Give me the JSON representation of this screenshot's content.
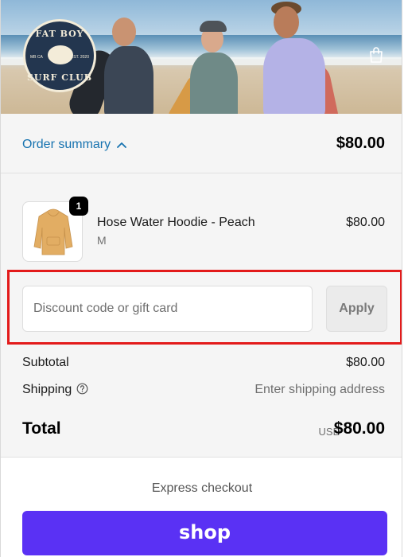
{
  "brand": {
    "logo_text_top": "FAT BOY",
    "logo_text_bottom": "SURF CLUB",
    "logo_small_left": "MB CA",
    "logo_small_right": "EST. 2020"
  },
  "header": {
    "bag_icon": "shopping-bag-icon"
  },
  "order_summary": {
    "toggle_label": "Order summary",
    "toggle_icon": "chevron-up-icon",
    "total": "$80.00",
    "accent_color": "#1773b0"
  },
  "line_items": [
    {
      "name": "Hose Water Hoodie - Peach",
      "variant": "M",
      "price": "$80.00",
      "quantity": "1"
    }
  ],
  "discount": {
    "placeholder": "Discount code or gift card",
    "value": "",
    "apply_label": "Apply",
    "highlight_color": "#e31b1b"
  },
  "totals": {
    "subtotal_label": "Subtotal",
    "subtotal_value": "$80.00",
    "shipping_label": "Shipping",
    "shipping_help_icon": "question-circle-icon",
    "shipping_value": "Enter shipping address",
    "total_label": "Total",
    "currency": "USD",
    "total_value": "$80.00"
  },
  "express_checkout": {
    "label": "Express checkout",
    "shop_pay_label": "shop",
    "shop_pay_color": "#5a31f4"
  }
}
